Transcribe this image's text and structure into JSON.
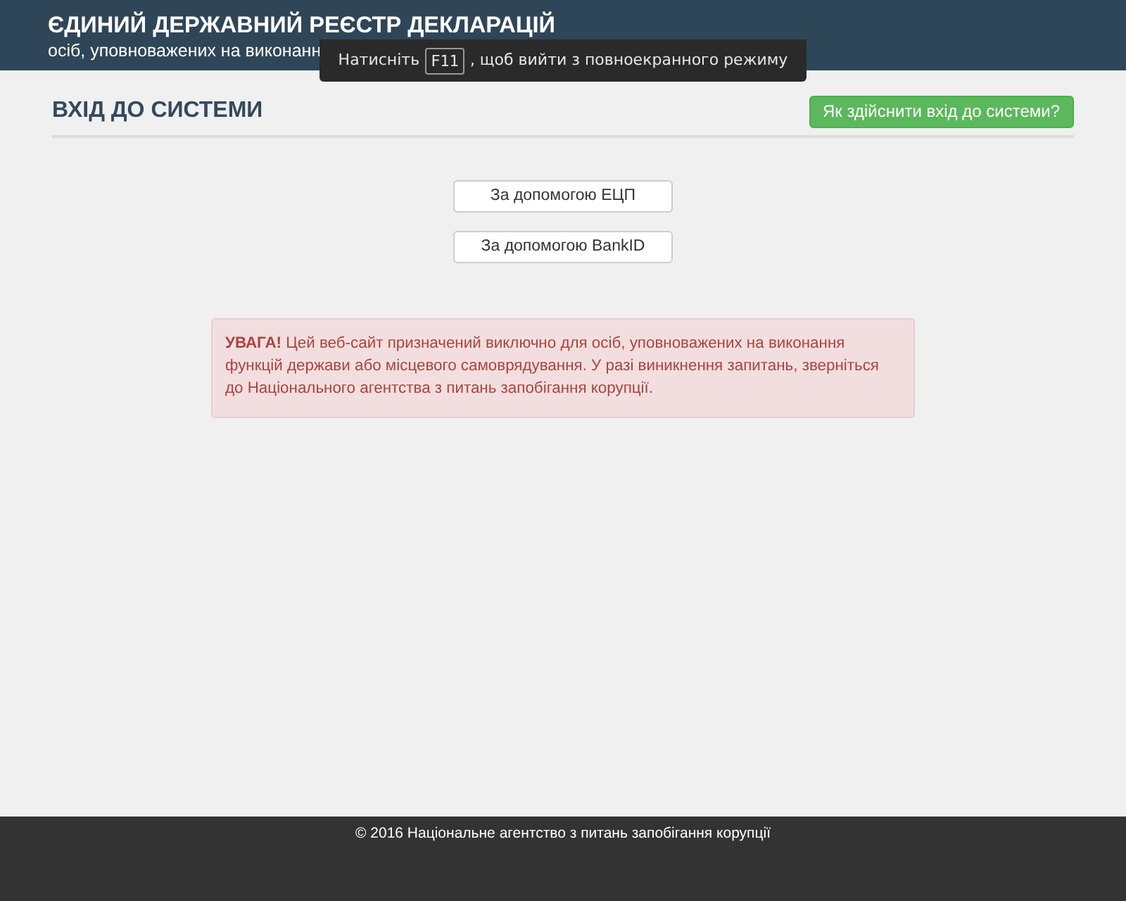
{
  "header": {
    "title": "ЄДИНИЙ ДЕРЖАВНИЙ РЕЄСТР ДЕКЛАРАЦІЙ",
    "subtitle": "осіб, уповноважених на виконанн"
  },
  "fullscreen_notice": {
    "before": "Натисніть",
    "key": "F11",
    "after": ", щоб вийти з повноекранного режиму"
  },
  "page": {
    "heading": "ВХІД ДО СИСТЕМИ",
    "help_button": "Як здійснити вхід до системи?"
  },
  "login_buttons": [
    "За допомогою ЕЦП",
    "За допомогою BankID"
  ],
  "alert": {
    "text": "**УВАГА!** Цей веб-сайт призначений виключно для осіб, уповноважених на виконання функцій держави або місцевого самоврядування. У разі виникнення запитань, зверніться до Національного агентства з питань запобігання корупції."
  },
  "footer": {
    "text": "© 2016 Національне агентство з питань запобігання корупції"
  }
}
